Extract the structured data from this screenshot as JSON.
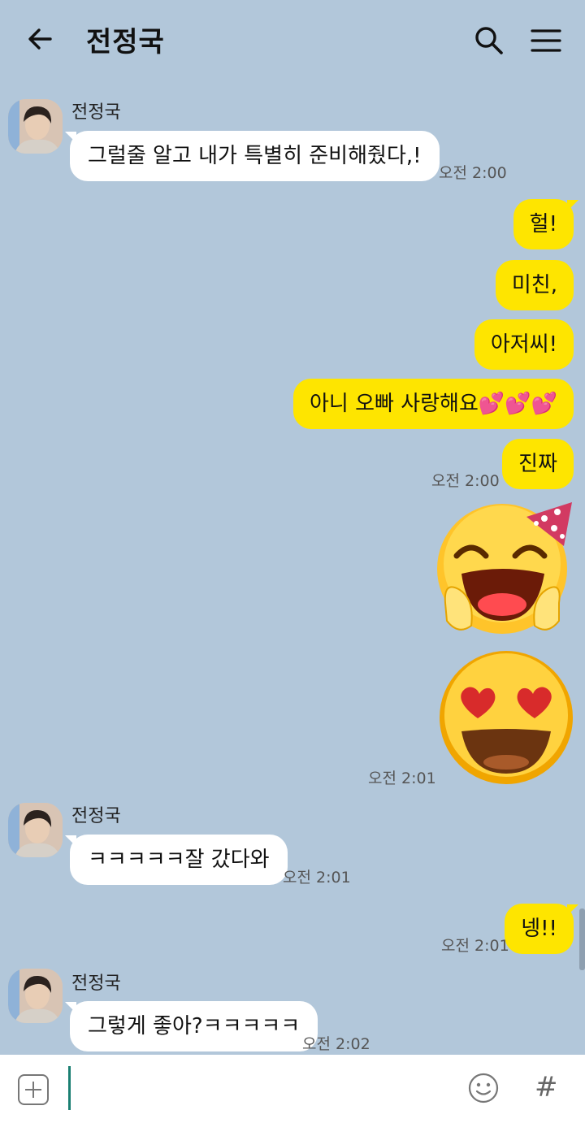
{
  "header": {
    "title": "전정국",
    "back_icon": "arrow-left-icon",
    "search_icon": "search-icon",
    "menu_icon": "hamburger-menu-icon"
  },
  "messages": {
    "m1": {
      "sender": "전정국",
      "text": "그럴줄 알고 내가 특별히 준비해줬다,!",
      "time": "오전 2:00"
    },
    "m2": {
      "text": "헐!"
    },
    "m3": {
      "text": "미친,"
    },
    "m4": {
      "text": "아저씨!"
    },
    "m5": {
      "text": "아니 오빠 사랑해요💕💕💕"
    },
    "m6": {
      "text": "진짜",
      "time": "오전 2:00"
    },
    "m7": {
      "emoji1": "party-laughing-emoticon",
      "emoji2": "heart-eyes-emoticon",
      "time": "오전 2:01"
    },
    "m8": {
      "sender": "전정국",
      "text": "ㅋㅋㅋㅋㅋ잘 갔다와",
      "time": "오전 2:01"
    },
    "m9": {
      "text": "넹!!",
      "time": "오전 2:01"
    },
    "m10": {
      "sender": "전정국",
      "text": "그렇게 좋아?ㅋㅋㅋㅋㅋ",
      "time": "오전 2:02"
    }
  },
  "input": {
    "plus_icon": "plus-box-icon",
    "emoji_icon": "smiley-icon",
    "hash_label": "#"
  },
  "colors": {
    "background": "#b2c7da",
    "outgoing_bubble": "#fee500",
    "incoming_bubble": "#ffffff"
  }
}
